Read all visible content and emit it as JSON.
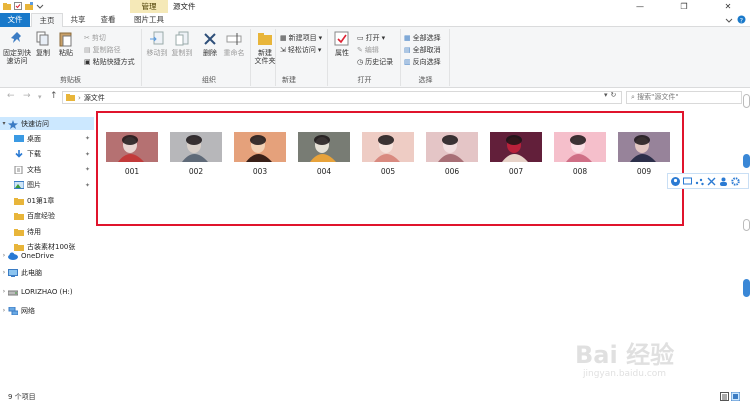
{
  "titlebar": {
    "context_tab": "管理",
    "window_title": "源文件",
    "minimize": "—",
    "maximize": "❐",
    "close": "✕"
  },
  "tabs": {
    "file": "文件",
    "home": "主页",
    "share": "共享",
    "view": "查看",
    "picture_tools": "图片工具"
  },
  "ribbon": {
    "clipboard": {
      "label": "剪贴板",
      "pin_quick_access": "固定到快\n速访问",
      "copy": "复制",
      "paste": "粘贴",
      "cut": "剪切",
      "copy_path": "复制路径",
      "paste_shortcut": "粘贴快捷方式"
    },
    "organize": {
      "label": "组织",
      "move_to": "移动到",
      "copy_to": "复制到",
      "delete": "删除",
      "rename": "重命名"
    },
    "new": {
      "label": "新建",
      "new_folder": "新建\n文件夹",
      "new_item": "新建项目",
      "easy_access": "轻松访问"
    },
    "open": {
      "label": "打开",
      "properties": "属性",
      "open": "打开",
      "edit": "编辑",
      "history": "历史记录"
    },
    "select": {
      "label": "选择",
      "select_all": "全部选择",
      "select_none": "全部取消",
      "invert": "反向选择"
    }
  },
  "address": {
    "path": "源文件",
    "search_placeholder": "搜索\"源文件\""
  },
  "nav": {
    "quick_access": "快速访问",
    "items": [
      "桌面",
      "下载",
      "文档",
      "图片",
      "01第1章",
      "百度经验",
      "待用",
      "古装素材100张"
    ],
    "onedrive": "OneDrive",
    "this_pc": "此电脑",
    "drive": "LORIZHAO (H:)",
    "network": "网络"
  },
  "files": [
    {
      "name": "001",
      "colors": [
        "#8a1f22",
        "#e9d6d2",
        "#c23a3a"
      ]
    },
    {
      "name": "002",
      "colors": [
        "#9aa2ad",
        "#d9d0c9",
        "#5f6a78"
      ]
    },
    {
      "name": "003",
      "colors": [
        "#d87a4a",
        "#f3d1b5",
        "#3a2018"
      ]
    },
    {
      "name": "004",
      "colors": [
        "#1d2a24",
        "#e6e1d6",
        "#e7a23a"
      ]
    },
    {
      "name": "005",
      "colors": [
        "#e8b9b0",
        "#f6e2dc",
        "#d98a80"
      ]
    },
    {
      "name": "006",
      "colors": [
        "#d8aeb0",
        "#f2dfe0",
        "#a86f76"
      ]
    },
    {
      "name": "007",
      "colors": [
        "#1b1f3a",
        "#b8213a",
        "#e7d2c8"
      ]
    },
    {
      "name": "008",
      "colors": [
        "#f0a4b4",
        "#fbe0e6",
        "#cf6f86"
      ]
    },
    {
      "name": "009",
      "colors": [
        "#5a4a7a",
        "#e3c7c2",
        "#2c2f4a"
      ]
    }
  ],
  "status": {
    "count": "9 个项目"
  },
  "watermark": {
    "text": "Bai 经验",
    "sub": "jingyan.baidu.com"
  },
  "colors": {
    "accent": "#1979ca",
    "highlight_border": "#e0142c",
    "selected": "#cce8ff"
  }
}
